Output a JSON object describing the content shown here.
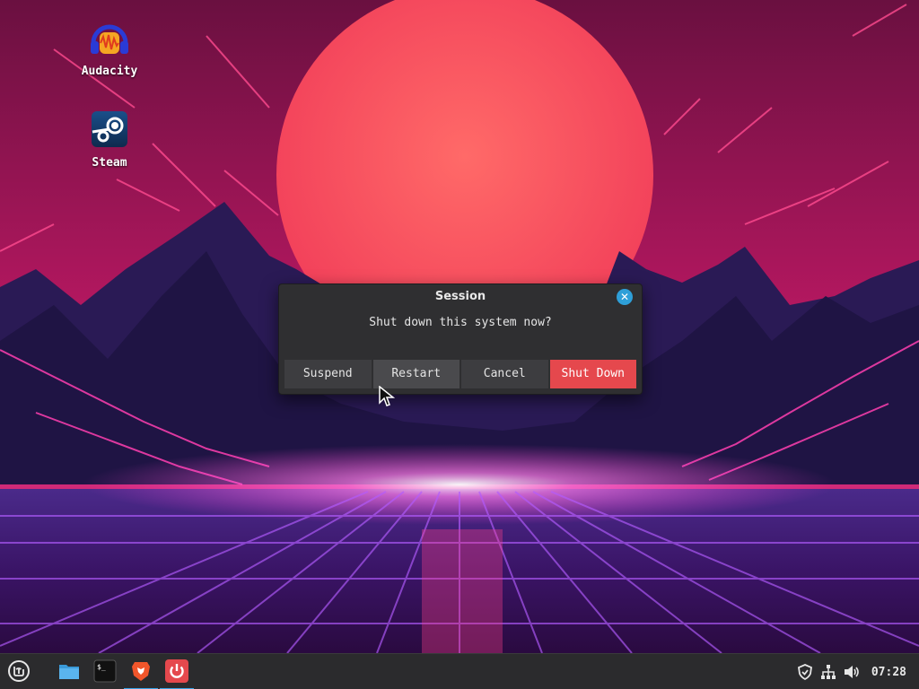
{
  "desktop": {
    "icons": [
      {
        "label": "Audacity",
        "icon": "audacity-icon"
      },
      {
        "label": "Steam",
        "icon": "steam-icon"
      }
    ]
  },
  "dialog": {
    "title": "Session",
    "message": "Shut down this system now?",
    "buttons": {
      "suspend": "Suspend",
      "restart": "Restart",
      "cancel": "Cancel",
      "shutdown": "Shut Down"
    },
    "close_icon": "close-icon",
    "accent_color": "#2e9fd8",
    "danger_color": "#e5484d"
  },
  "taskbar": {
    "menu_icon": "linux-mint-menu-icon",
    "launchers": [
      {
        "icon": "file-manager-icon"
      },
      {
        "icon": "terminal-icon"
      },
      {
        "icon": "brave-browser-icon"
      },
      {
        "icon": "power-icon"
      }
    ],
    "tray": [
      {
        "icon": "shield-icon"
      },
      {
        "icon": "network-icon"
      },
      {
        "icon": "volume-icon"
      }
    ],
    "clock": "07:28"
  }
}
